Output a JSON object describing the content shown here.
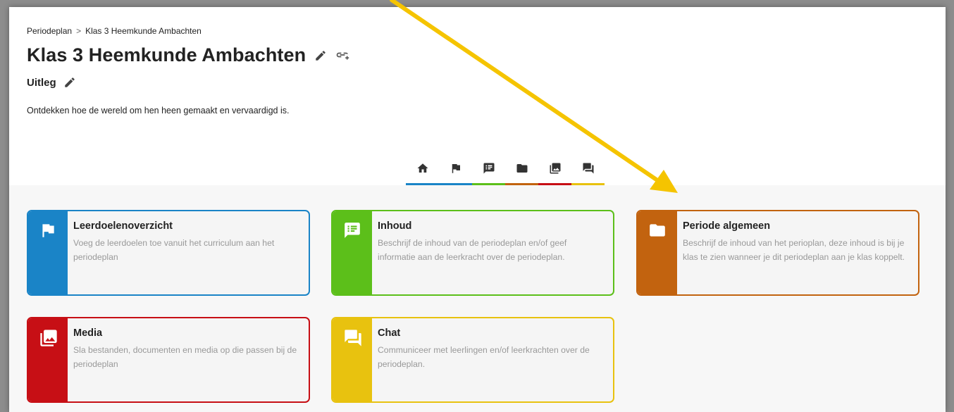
{
  "breadcrumb": {
    "root": "Periodeplan",
    "separator": ">",
    "current": "Klas 3 Heemkunde Ambachten"
  },
  "page_title": "Klas 3 Heemkunde Ambachten",
  "section": {
    "title": "Uitleg",
    "description": "Ontdekken hoe de wereld om hen heen gemaakt en vervaardigd is."
  },
  "tabs": [
    {
      "icon": "home-icon",
      "color": "#1a84c7"
    },
    {
      "icon": "flag-icon",
      "color": "#1a84c7"
    },
    {
      "icon": "list-icon",
      "color": "#5cbf1a"
    },
    {
      "icon": "folder-icon",
      "color": "#c2630f"
    },
    {
      "icon": "media-icon",
      "color": "#c70f15"
    },
    {
      "icon": "chat-icon",
      "color": "#e8c20f"
    }
  ],
  "cards": [
    {
      "title": "Leerdoelenoverzicht",
      "text": "Voeg de leerdoelen toe vanuit het curriculum aan het periodeplan",
      "color": "#1a84c7",
      "icon": "flag-icon"
    },
    {
      "title": "Inhoud",
      "text": "Beschrijf de inhoud van de periodeplan en/of geef informatie aan de leerkracht over de periodeplan.",
      "color": "#5cbf1a",
      "icon": "list-icon"
    },
    {
      "title": "Periode algemeen",
      "text": "Beschrijf de inhoud van het perioplan, deze inhoud is bij je klas te zien wanneer je dit periodeplan aan je klas koppelt.",
      "color": "#c2630f",
      "icon": "folder-icon"
    },
    {
      "title": "Media",
      "text": "Sla bestanden, documenten en media op die passen bij de periodeplan",
      "color": "#c70f15",
      "icon": "media-icon"
    },
    {
      "title": "Chat",
      "text": "Communiceer met leerlingen en/of leerkrachten over de periodeplan.",
      "color": "#e8c20f",
      "icon": "chat-icon"
    }
  ],
  "annotation": {
    "arrow_color": "#f5c400"
  }
}
